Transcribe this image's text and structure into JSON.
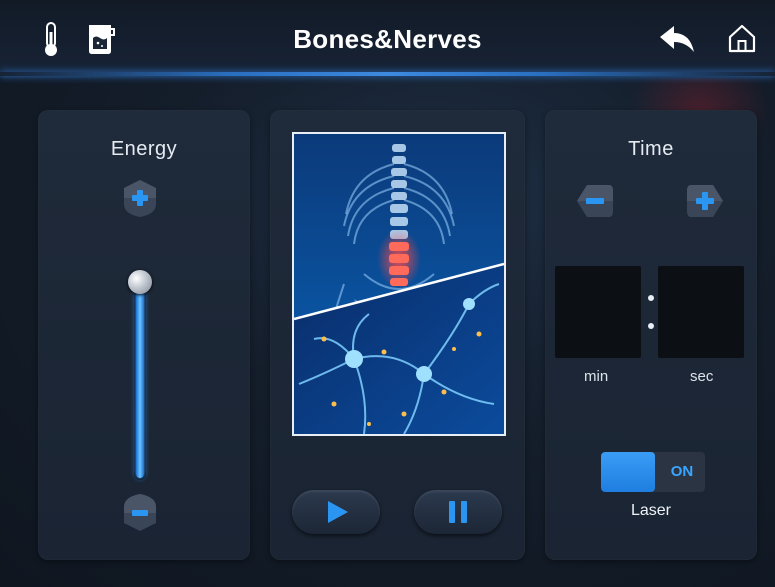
{
  "header": {
    "title": "Bones&Nerves",
    "icons": [
      "thermometer-icon",
      "water-tank-icon",
      "back-arrow-icon",
      "home-icon"
    ]
  },
  "energy": {
    "label": "Energy",
    "level": 0.95,
    "increase_icon": "plus-icon",
    "decrease_icon": "minus-icon"
  },
  "center": {
    "image": "spine-and-neurons-illustration",
    "play_icon": "play-icon",
    "pause_icon": "pause-icon"
  },
  "time": {
    "label": "Time",
    "min_value": "",
    "sec_value": "",
    "min_label": "min",
    "sec_label": "sec",
    "decrease_icon": "minus-icon",
    "increase_icon": "plus-icon"
  },
  "laser": {
    "label": "Laser",
    "state": "ON"
  },
  "colors": {
    "accent": "#2f8ff0",
    "background": "#141d2a",
    "panel": "#1d2737"
  }
}
